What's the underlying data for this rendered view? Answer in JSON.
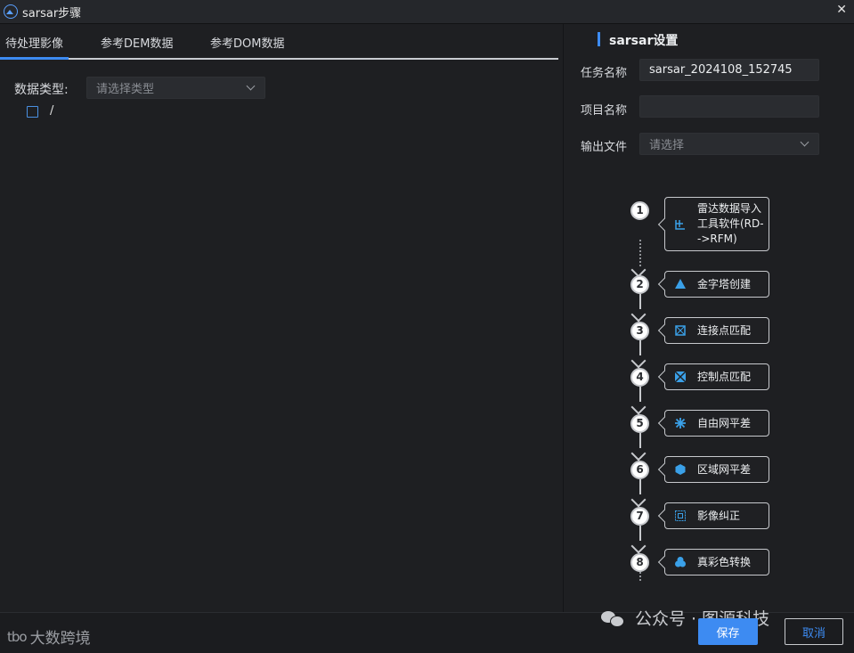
{
  "window": {
    "title": "sarsar步骤",
    "close_glyph": "✕"
  },
  "tabs": [
    {
      "label": "待处理影像",
      "active": true
    },
    {
      "label": "参考DEM数据",
      "active": false
    },
    {
      "label": "参考DOM数据",
      "active": false
    }
  ],
  "left": {
    "data_type_label": "数据类型:",
    "data_type_placeholder": "请选择类型",
    "tree_item_label": "/"
  },
  "settings": {
    "title": "sarsar设置",
    "task_name_label": "任务名称",
    "task_name_value": "sarsar_2024108_152745",
    "project_name_label": "项目名称",
    "project_name_value": "",
    "output_file_label": "输出文件",
    "output_file_placeholder": "请选择"
  },
  "steps": [
    {
      "num": "1",
      "label": "雷达数据导入工具软件(RD-->RFM)",
      "icon": "import-icon"
    },
    {
      "num": "2",
      "label": "金字塔创建",
      "icon": "pyramid-icon"
    },
    {
      "num": "3",
      "label": "连接点匹配",
      "icon": "tie-point-icon"
    },
    {
      "num": "4",
      "label": "控制点匹配",
      "icon": "control-point-icon"
    },
    {
      "num": "5",
      "label": "自由网平差",
      "icon": "free-network-icon"
    },
    {
      "num": "6",
      "label": "区域网平差",
      "icon": "block-adjust-icon"
    },
    {
      "num": "7",
      "label": "影像纠正",
      "icon": "rectify-icon"
    },
    {
      "num": "8",
      "label": "真彩色转换",
      "icon": "true-color-icon"
    }
  ],
  "footer": {
    "save_label": "保存",
    "cancel_label": "取消",
    "watermark_left": "大数跨境",
    "watermark_left_logo": "tbo",
    "watermark_right": "公众号 · 图源科技"
  },
  "colors": {
    "accent": "#3d8bf2",
    "background": "#1e1f22",
    "icon": "#3aa0e8"
  }
}
